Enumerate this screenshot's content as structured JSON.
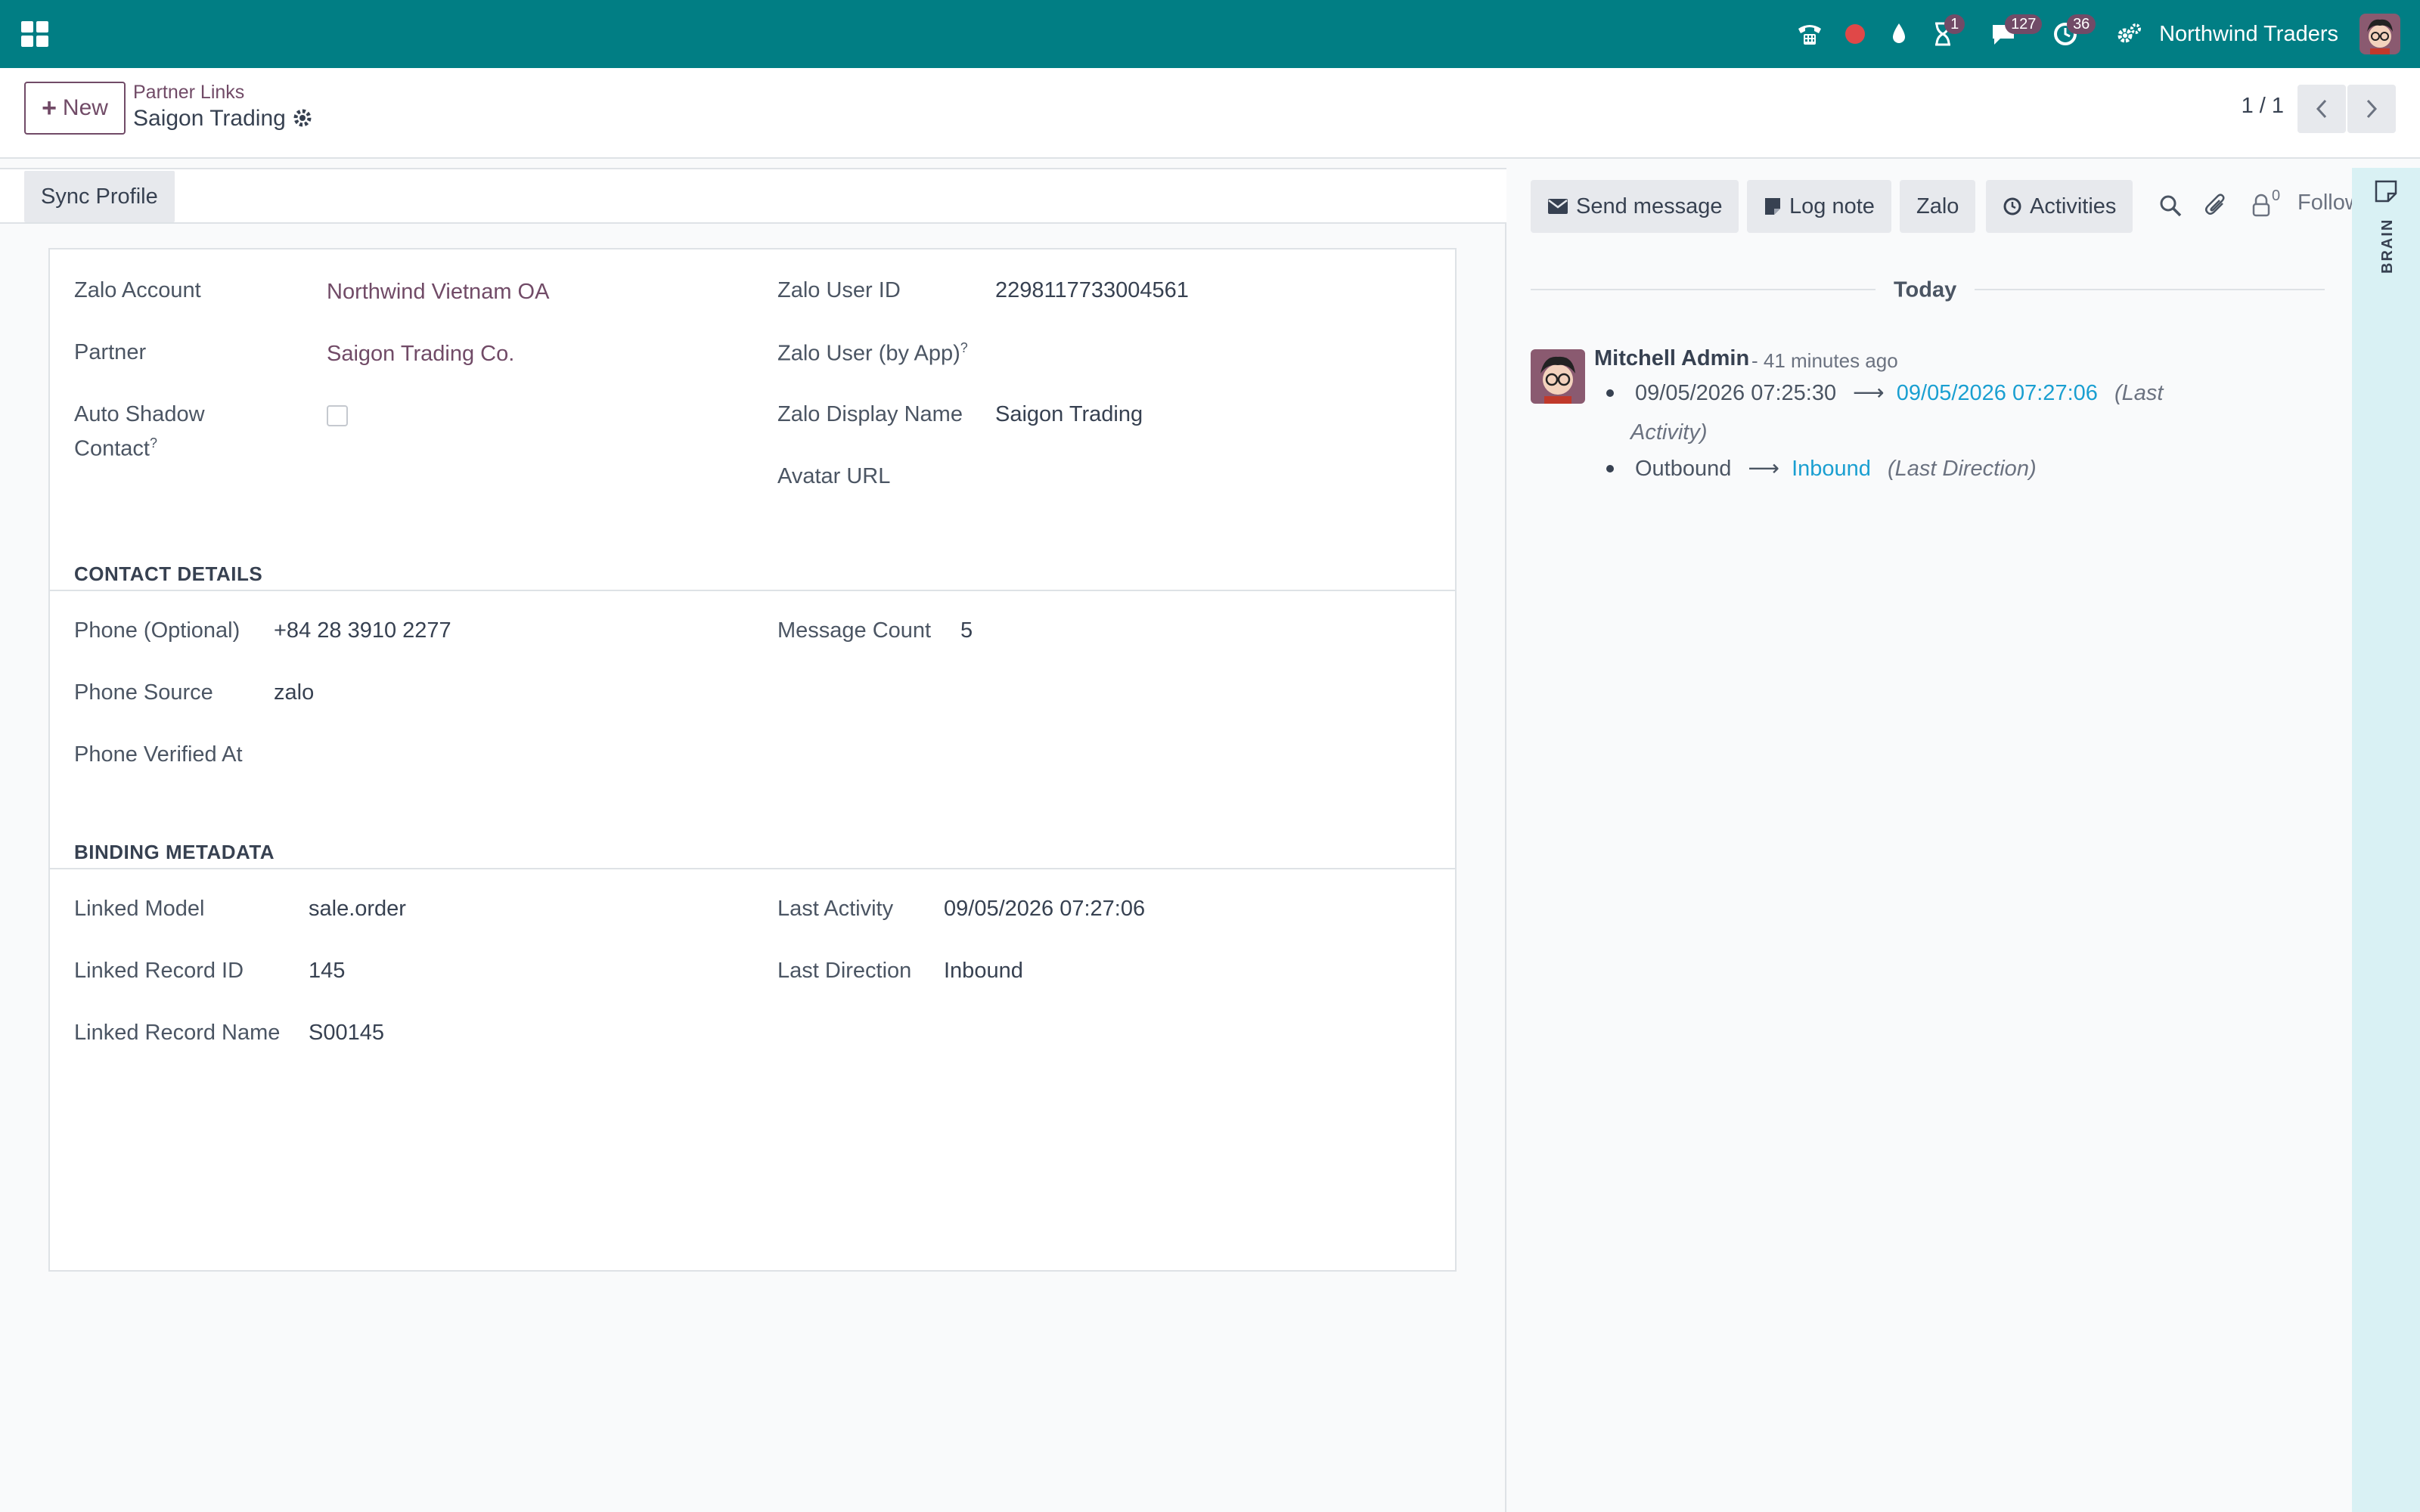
{
  "navbar": {
    "badges": {
      "activity": "1",
      "messages": "127",
      "timer": "36"
    },
    "company": "Northwind Traders"
  },
  "control_panel": {
    "new_label": "New",
    "breadcrumb_parent": "Partner Links",
    "breadcrumb_current": "Saigon Trading",
    "pager": "1 / 1"
  },
  "statusbar": {
    "sync_label": "Sync Profile"
  },
  "form": {
    "zalo_account": {
      "label": "Zalo Account",
      "value": "Northwind Vietnam OA"
    },
    "partner": {
      "label": "Partner",
      "value": "Saigon Trading Co."
    },
    "auto_shadow": {
      "label_line1": "Auto Shadow",
      "label_line2": "Contact",
      "help": "?"
    },
    "zalo_user_id": {
      "label": "Zalo User ID",
      "value": "2298117733004561"
    },
    "zalo_user_by_app": {
      "label": "Zalo User (by App)",
      "help": "?",
      "value": ""
    },
    "zalo_display_name": {
      "label": "Zalo Display Name",
      "value": "Saigon Trading"
    },
    "avatar_url": {
      "label": "Avatar URL",
      "value": ""
    },
    "contact_section": "CONTACT DETAILS",
    "phone": {
      "label": "Phone (Optional)",
      "value": "+84 28 3910 2277"
    },
    "phone_source": {
      "label": "Phone Source",
      "value": "zalo"
    },
    "phone_verified": {
      "label": "Phone Verified At",
      "value": ""
    },
    "message_count": {
      "label": "Message Count",
      "value": "5"
    },
    "binding_section": "BINDING METADATA",
    "linked_model": {
      "label": "Linked Model",
      "value": "sale.order"
    },
    "linked_record_id": {
      "label": "Linked Record ID",
      "value": "145"
    },
    "linked_record_name": {
      "label": "Linked Record Name",
      "value": "S00145"
    },
    "last_activity": {
      "label": "Last Activity",
      "value": "09/05/2026 07:27:06"
    },
    "last_direction": {
      "label": "Last Direction",
      "value": "Inbound"
    }
  },
  "chatter": {
    "send_message": "Send message",
    "log_note": "Log note",
    "zalo": "Zalo",
    "activities": "Activities",
    "followers_count": "0",
    "follow_label": "Follow",
    "today": "Today",
    "message": {
      "author": "Mitchell Admin",
      "time": "- 41 minutes ago",
      "changes": [
        {
          "old": "09/05/2026 07:25:30",
          "new": "09/05/2026 07:27:06",
          "field_line1": "(Last",
          "field_line2": "Activity)"
        },
        {
          "old": "Outbound",
          "new": "Inbound",
          "field": "(Last Direction)"
        }
      ]
    }
  },
  "sidebar": {
    "brain_label": "BRAIN"
  },
  "colors": {
    "navbar": "#017e84",
    "brand": "#714B67",
    "link_new_value": "#1a9fd1",
    "brain_bar": "#d9f1f4"
  }
}
